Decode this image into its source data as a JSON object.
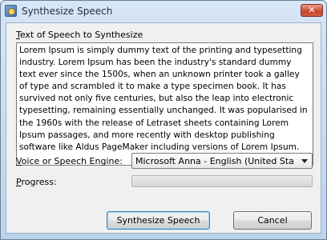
{
  "window": {
    "title": "Synthesize Speech",
    "close_glyph": "✕"
  },
  "text_group": {
    "label_hotkey": "T",
    "label_rest": "ext of Speech to Synthesize",
    "value": "Lorem Ipsum is simply dummy text of the printing and typesetting industry. Lorem Ipsum has been the industry's standard dummy text ever since the 1500s, when an unknown printer took a galley of type and scrambled it to make a type specimen book. It has survived not only five centuries, but also the leap into electronic typesetting, remaining essentially unchanged. It was popularised in the 1960s with the release of Letraset sheets containing Lorem Ipsum passages, and more recently with desktop publishing software like Aldus PageMaker including versions of Lorem Ipsum."
  },
  "voice": {
    "label_hotkey": "V",
    "label_rest": "oice or Speech Engine:",
    "selected": "Microsoft Anna - English (United States)"
  },
  "progress": {
    "label_hotkey": "P",
    "label_rest": "rogress:",
    "value": 0
  },
  "buttons": {
    "synthesize_label": "Synthesize Speech",
    "cancel_label": "Cancel"
  },
  "icons": {
    "app": "app-icon",
    "close": "close-icon",
    "dropdown": "chevron-down-icon"
  }
}
